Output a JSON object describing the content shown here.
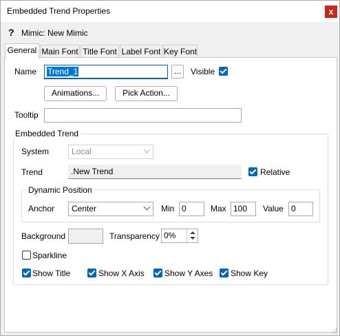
{
  "window": {
    "title": "Embedded Trend Properties",
    "close_glyph": "x"
  },
  "header": {
    "help_glyph": "?",
    "mimic_text": "Mimic: New Mimic"
  },
  "tabs": [
    {
      "label": "General",
      "active": true
    },
    {
      "label": "Main Font",
      "active": false
    },
    {
      "label": "Title Font",
      "active": false
    },
    {
      "label": "Label Font",
      "active": false
    },
    {
      "label": "Key Font",
      "active": false
    }
  ],
  "general": {
    "name_label": "Name",
    "name_value": "Trend_1",
    "browse_label": "...",
    "visible_label": "Visible",
    "visible_checked": true,
    "animations_label": "Animations...",
    "pick_action_label": "Pick Action...",
    "tooltip_label": "Tooltip",
    "tooltip_value": ""
  },
  "embedded_trend": {
    "group_label": "Embedded Trend",
    "system_label": "System",
    "system_value": "Local",
    "trend_label": "Trend",
    "trend_value": ".New Trend",
    "relative_label": "Relative",
    "relative_checked": true,
    "dynamic_position": {
      "group_label": "Dynamic Position",
      "anchor_label": "Anchor",
      "anchor_value": "Center",
      "min_label": "Min",
      "min_value": "0",
      "max_label": "Max",
      "max_value": "100",
      "value_label": "Value",
      "value_value": "0"
    },
    "background_label": "Background",
    "transparency_label": "Transparency",
    "transparency_value": "0%",
    "sparkline_label": "Sparkline",
    "sparkline_checked": false,
    "show_title_label": "Show Title",
    "show_x_axis_label": "Show X Axis",
    "show_y_axes_label": "Show Y Axes",
    "show_key_label": "Show Key"
  },
  "colors": {
    "accent": "#0067c0",
    "close": "#c42b1c",
    "window_bg": "#f0f0f0"
  }
}
